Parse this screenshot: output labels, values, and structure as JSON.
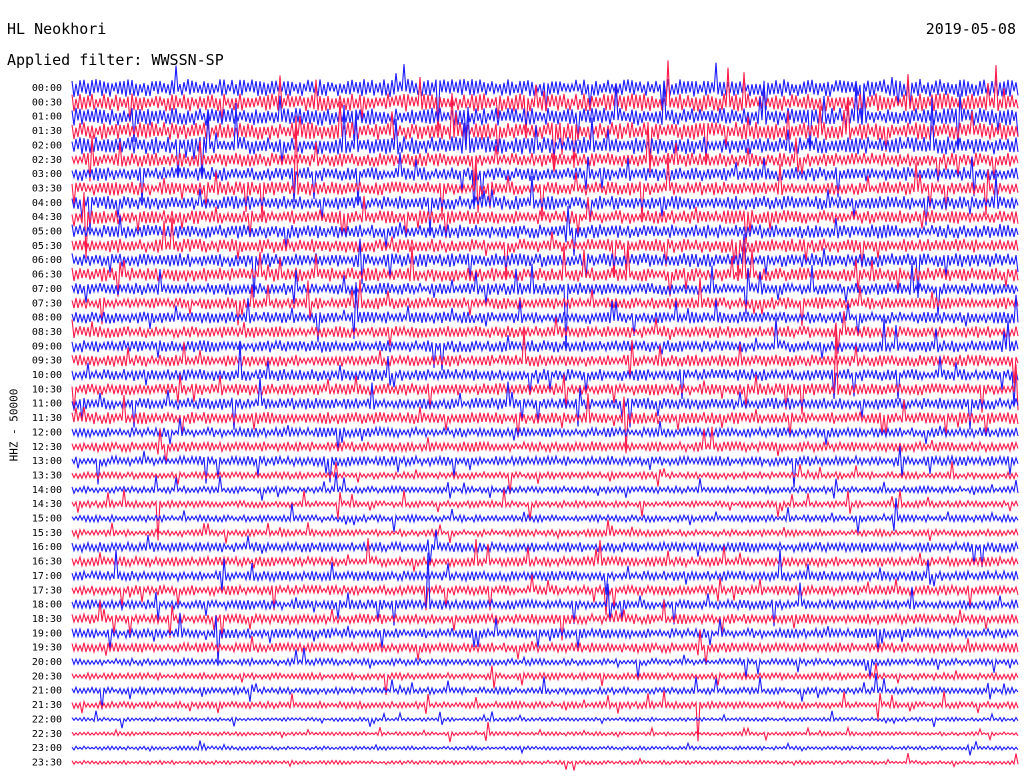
{
  "header": {
    "station": "HL Neokhori",
    "filter": "Applied filter: WWSSN-SP",
    "date": "2019-05-08"
  },
  "chart_data": {
    "type": "line",
    "title": "HL Neokhori",
    "subtitle": "Applied filter: WWSSN-SP",
    "ylabel": "HHZ - 50000",
    "row_labels": [
      "00:00",
      "00:30",
      "01:00",
      "01:30",
      "02:00",
      "02:30",
      "03:00",
      "03:30",
      "04:00",
      "04:30",
      "05:00",
      "05:30",
      "06:00",
      "06:30",
      "07:00",
      "07:30",
      "08:00",
      "08:30",
      "09:00",
      "09:30",
      "10:00",
      "10:30",
      "11:00",
      "11:30",
      "12:00",
      "12:30",
      "13:00",
      "13:30",
      "14:00",
      "14:30",
      "15:00",
      "15:30",
      "16:00",
      "16:30",
      "17:00",
      "17:30",
      "18:00",
      "18:30",
      "19:00",
      "19:30",
      "20:00",
      "20:30",
      "21:00",
      "21:30",
      "22:00",
      "22:30",
      "23:00",
      "23:30"
    ],
    "trace_colors": [
      "#1a1aff",
      "#ff1a4a"
    ],
    "grid": false
  }
}
